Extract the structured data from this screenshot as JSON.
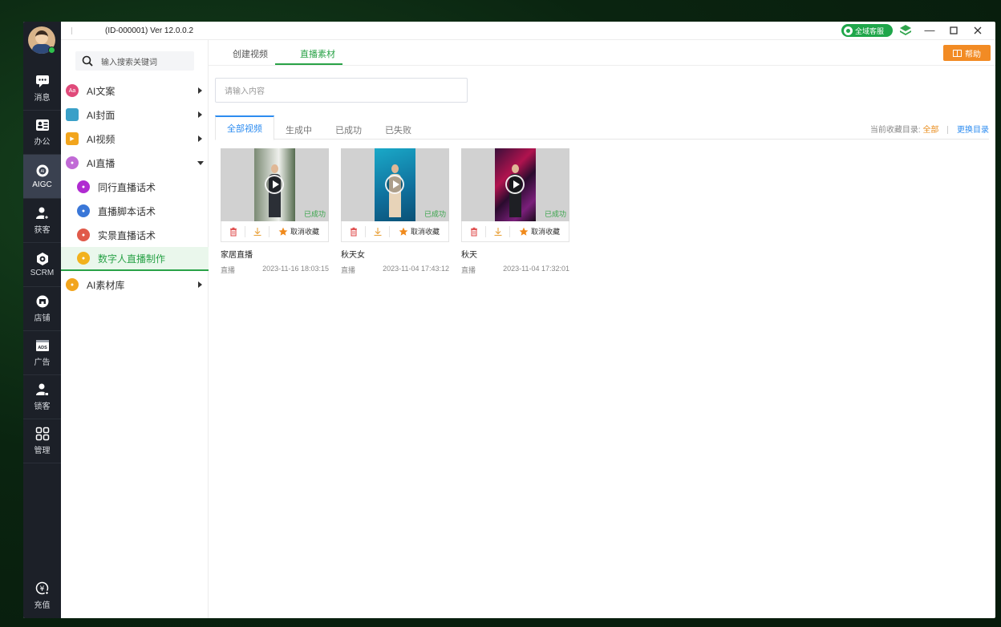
{
  "app": {
    "version_text": "(ID-000001)  Ver 12.0.0.2"
  },
  "titlebar": {
    "service_label": "全域客服"
  },
  "rail": {
    "items": [
      {
        "label": "消息",
        "icon": "chat-icon"
      },
      {
        "label": "办公",
        "icon": "contacts-icon"
      },
      {
        "label": "AIGC",
        "icon": "aigc-icon"
      },
      {
        "label": "获客",
        "icon": "add-user-icon"
      },
      {
        "label": "SCRM",
        "icon": "scrm-icon"
      },
      {
        "label": "店铺",
        "icon": "store-icon"
      },
      {
        "label": "广告",
        "icon": "ads-icon"
      },
      {
        "label": "锁客",
        "icon": "lock-user-icon"
      },
      {
        "label": "管理",
        "icon": "grid-icon"
      }
    ],
    "recharge_label": "充值"
  },
  "sidenav": {
    "search_placeholder": "输入搜索关键词",
    "items": [
      {
        "label": "AI文案",
        "color": "#e04a7a"
      },
      {
        "label": "AI封面",
        "color": "#3aa0c8"
      },
      {
        "label": "AI视频",
        "color": "#f2a51d"
      },
      {
        "label": "AI直播",
        "color": "#c16ad6"
      }
    ],
    "sub_items": [
      {
        "label": "同行直播话术",
        "color": "#b02bd1"
      },
      {
        "label": "直播脚本话术",
        "color": "#3a77d8"
      },
      {
        "label": "实景直播话术",
        "color": "#e05a4a"
      },
      {
        "label": "数字人直播制作",
        "color": "#f2b21d"
      }
    ],
    "library_label": "AI素材库",
    "library_color": "#f2a51d"
  },
  "main": {
    "tabs": [
      "创建视频",
      "直播素材"
    ],
    "help_label": "帮助",
    "input_placeholder": "请输入内容",
    "sub_tabs": [
      "全部视频",
      "生成中",
      "已成功",
      "已失败"
    ],
    "dir_label": "当前收藏目录:",
    "dir_current": "全部",
    "dir_change": "更换目录"
  },
  "cards": [
    {
      "title": "家居直播",
      "type": "直播",
      "date": "2023-11-16 18:03:15",
      "status": "已成功",
      "fav_label": "取消收藏"
    },
    {
      "title": "秋天女",
      "type": "直播",
      "date": "2023-11-04 17:43:12",
      "status": "已成功",
      "fav_label": "取消收藏"
    },
    {
      "title": "秋天",
      "type": "直播",
      "date": "2023-11-04 17:32:01",
      "status": "已成功",
      "fav_label": "取消收藏"
    }
  ],
  "colors": {
    "accent": "#29a247",
    "link": "#2d8cf0",
    "warn": "#f28b24"
  }
}
